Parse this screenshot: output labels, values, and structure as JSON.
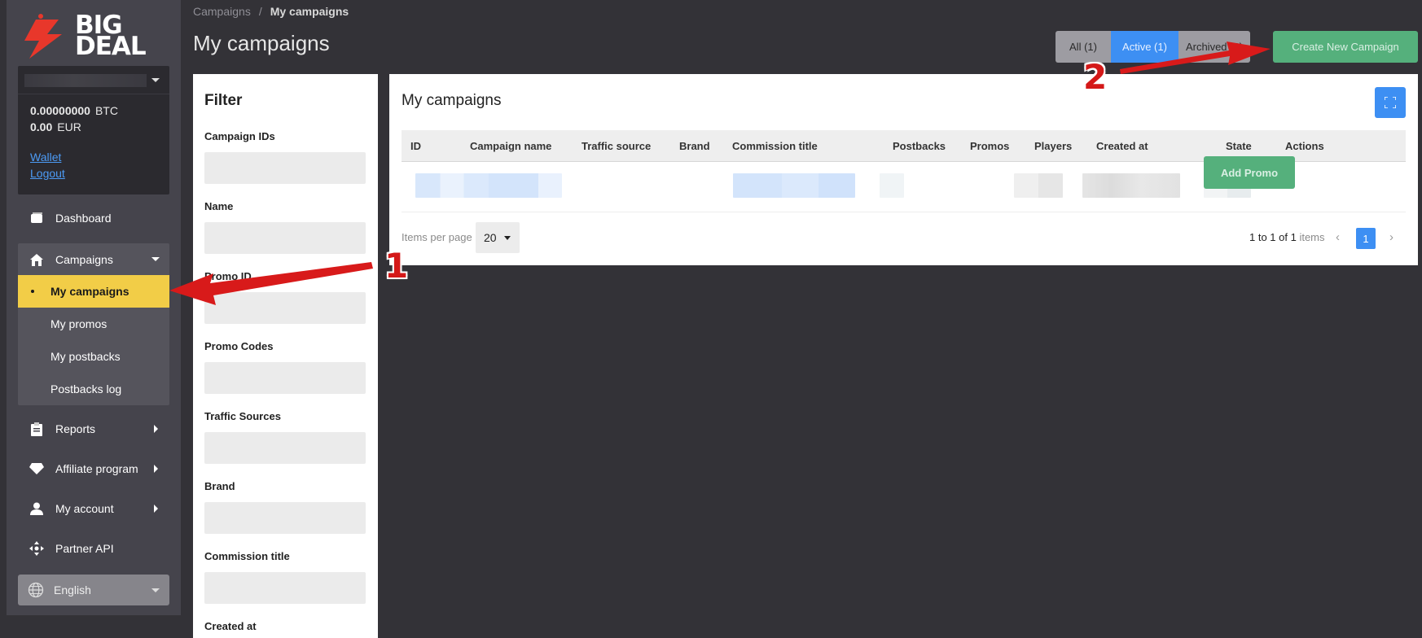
{
  "logo": {
    "text_line1": "BIG",
    "text_line2": "DEAL"
  },
  "account": {
    "balances": [
      {
        "amount": "0.00000000",
        "currency": "BTC"
      },
      {
        "amount": "0.00",
        "currency": "EUR"
      }
    ],
    "wallet_link": "Wallet",
    "logout_link": "Logout"
  },
  "sidebar": {
    "dashboard": "Dashboard",
    "campaigns": "Campaigns",
    "campaigns_sub": [
      "My campaigns",
      "My promos",
      "My postbacks",
      "Postbacks log"
    ],
    "reports": "Reports",
    "affiliate": "Affiliate program",
    "my_account": "My account",
    "partner_api": "Partner API",
    "language": "English"
  },
  "breadcrumb": {
    "parent": "Campaigns",
    "separator": "/",
    "current": "My campaigns"
  },
  "header": {
    "title": "My campaigns",
    "tabs": {
      "all": "All (1)",
      "active": "Active (1)",
      "archived": "Archived (0)"
    },
    "create_button": "Create New Campaign"
  },
  "filter": {
    "title": "Filter",
    "fields": [
      "Campaign IDs",
      "Name",
      "Promo ID",
      "Promo Codes",
      "Traffic Sources",
      "Brand",
      "Commission title",
      "Created at"
    ]
  },
  "table": {
    "title": "My campaigns",
    "columns": [
      "ID",
      "Campaign name",
      "Traffic source",
      "Brand",
      "Commission title",
      "Postbacks",
      "Promos",
      "Players",
      "Created at",
      "State",
      "Actions"
    ],
    "row_action": "Add Promo"
  },
  "pagination": {
    "items_per_page_label": "Items per page",
    "items_per_page_value": "20",
    "range_text": "1 to 1 of 1",
    "items_word": "items",
    "current_page": "1",
    "prev": "‹",
    "next": "›"
  },
  "annotations": {
    "step1": "1",
    "step2": "2"
  },
  "colors": {
    "accent_blue": "#3d8ff3",
    "accent_yellow": "#f2cd47",
    "accent_green": "#55b07c",
    "annotation_red": "#d41818"
  }
}
